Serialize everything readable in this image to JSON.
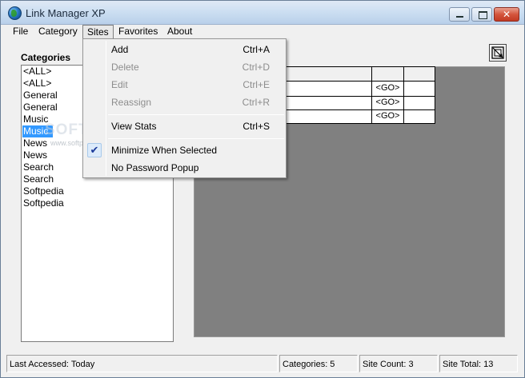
{
  "window": {
    "title": "Link Manager XP"
  },
  "menubar": [
    {
      "label": "File"
    },
    {
      "label": "Category"
    },
    {
      "label": "Sites"
    },
    {
      "label": "Favorites"
    },
    {
      "label": "About"
    }
  ],
  "categories": {
    "label": "Categories",
    "items": [
      "<ALL>",
      "<ALL>",
      "General",
      "General",
      "Music",
      "Music",
      "News",
      "News",
      "Search",
      "Search",
      "Softpedia",
      "Softpedia"
    ],
    "selected_index": 5
  },
  "watermark": {
    "text": "SOFTPEDIA",
    "small": "www.softpedia.com"
  },
  "sites_table": {
    "rows": [
      {
        "go": "<GO>"
      },
      {
        "go": "<GO>"
      },
      {
        "go": "<GO>"
      }
    ]
  },
  "sites_menu": {
    "items": [
      {
        "label": "Add",
        "shortcut": "Ctrl+A",
        "enabled": true
      },
      {
        "label": "Delete",
        "shortcut": "Ctrl+D",
        "enabled": false
      },
      {
        "label": "Edit",
        "shortcut": "Ctrl+E",
        "enabled": false
      },
      {
        "label": "Reassign",
        "shortcut": "Ctrl+R",
        "enabled": false
      },
      {
        "label": "View Stats",
        "shortcut": "Ctrl+S",
        "enabled": true
      },
      {
        "label": "Minimize When Selected",
        "checked": true,
        "enabled": true
      },
      {
        "label": "No Password Popup",
        "enabled": true
      }
    ],
    "check_glyph": "✔"
  },
  "statusbar": {
    "last_accessed": "Last Accessed: Today",
    "categories": "Categories: 5",
    "site_count": "Site Count: 3",
    "site_total": "Site Total: 13"
  }
}
